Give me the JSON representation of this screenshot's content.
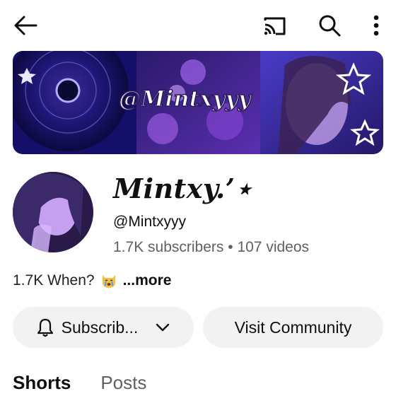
{
  "header": {
    "back_icon": "arrow-left-icon",
    "cast_icon": "cast-icon",
    "search_icon": "search-icon",
    "more_icon": "more-vert-icon"
  },
  "banner": {
    "text": "@Mintxyyy",
    "accent": "#6a3cff"
  },
  "channel": {
    "name": "Mintxy.’⋆",
    "handle": "@Mintxyyy",
    "subscribers": "1.7K subscribers",
    "separator": "•",
    "videos": "107 videos",
    "description": "1.7K When?",
    "emoji": "crying-cat-icon",
    "more": "...more"
  },
  "actions": {
    "subscribe_label": "Subscrib...",
    "visit_label": "Visit Community"
  },
  "tabs": [
    {
      "label": "Shorts",
      "active": true
    },
    {
      "label": "Posts",
      "active": false
    }
  ]
}
